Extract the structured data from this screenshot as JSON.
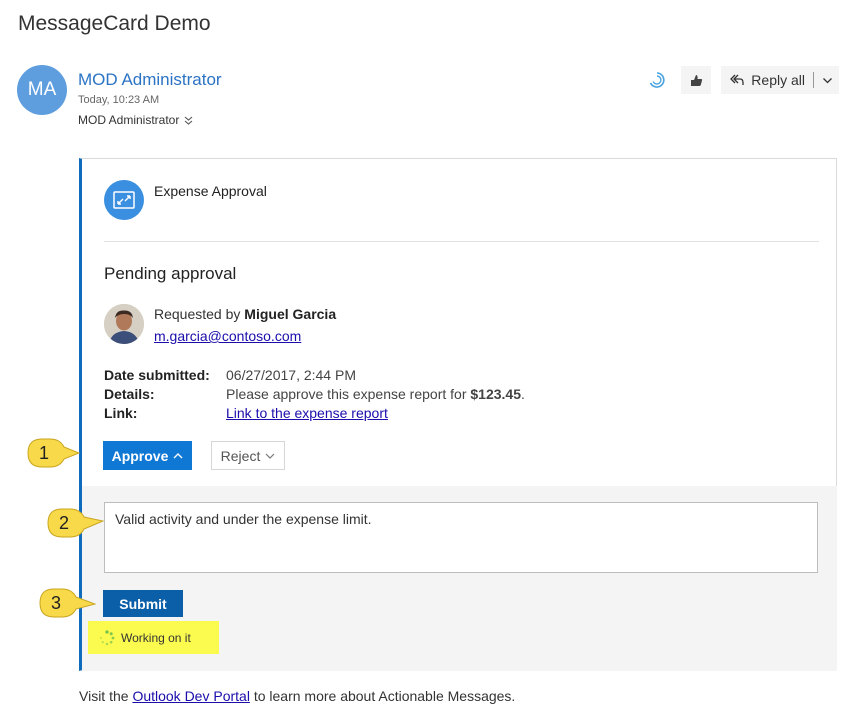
{
  "email": {
    "subject": "MessageCard Demo",
    "sender": {
      "initials": "MA",
      "name": "MOD Administrator",
      "time": "Today, 10:23 AM",
      "recipient": "MOD Administrator"
    },
    "actions": {
      "reply_all_label": "Reply all"
    }
  },
  "card": {
    "title": "Expense Approval",
    "heading": "Pending approval",
    "requested_prefix": "Requested by",
    "requester_name": "Miguel Garcia",
    "requester_email": "m.garcia@contoso.com",
    "facts": [
      {
        "key": "Date submitted:",
        "value": "06/27/2017, 2:44 PM"
      },
      {
        "key": "Details:",
        "value_prefix": "Please approve this expense report for",
        "value_bold": "$123.45",
        "value_suffix": "."
      },
      {
        "key": "Link:",
        "link_text": "Link to the expense report"
      }
    ],
    "buttons": {
      "approve": "Approve",
      "reject": "Reject",
      "submit": "Submit"
    },
    "comment": "Valid activity and under the expense limit.",
    "status": "Working on it"
  },
  "callouts": [
    "1",
    "2",
    "3"
  ],
  "footer": {
    "prefix": "Visit the",
    "link": "Outlook Dev Portal",
    "suffix": "to learn more about Actionable Messages."
  },
  "colors": {
    "accent": "#0f78d4",
    "card_border": "#0f6cbd",
    "highlight": "#fbfb4f",
    "callout": "#f8d94a"
  }
}
